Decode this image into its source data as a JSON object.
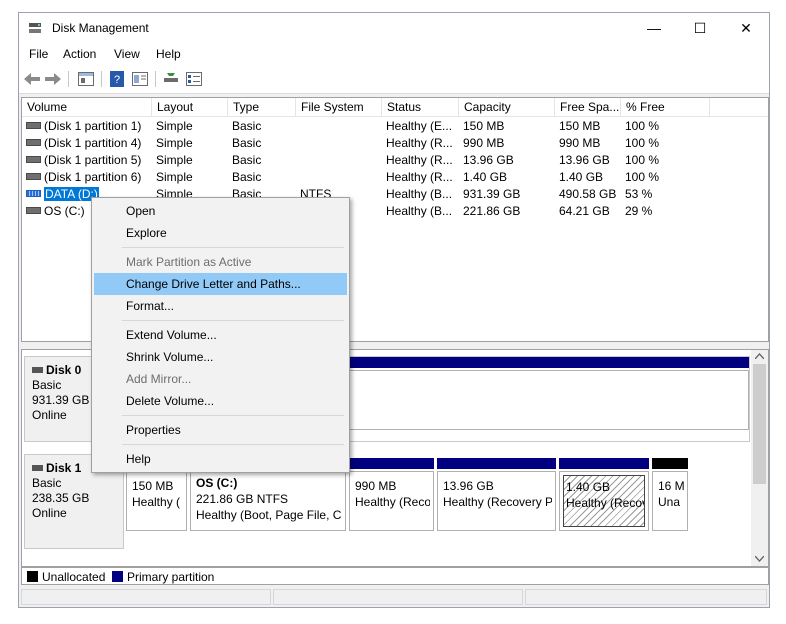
{
  "window": {
    "title": "Disk Management",
    "minimize_glyph": "—",
    "maximize_glyph": "☐",
    "close_glyph": "✕"
  },
  "menu": [
    "File",
    "Action",
    "View",
    "Help"
  ],
  "toolbar": [
    "back-icon",
    "forward-icon",
    "properties-icon",
    "help-icon",
    "console-icon",
    "refresh-icon",
    "list-icon"
  ],
  "columns": [
    "Volume",
    "Layout",
    "Type",
    "File System",
    "Status",
    "Capacity",
    "Free Spa...",
    "% Free"
  ],
  "volumes": [
    {
      "volume": "(Disk 1 partition 1)",
      "layout": "Simple",
      "type": "Basic",
      "fs": "",
      "status": "Healthy (E...",
      "capacity": "150 MB",
      "free": "150 MB",
      "pct": "100 %"
    },
    {
      "volume": "(Disk 1 partition 4)",
      "layout": "Simple",
      "type": "Basic",
      "fs": "",
      "status": "Healthy (R...",
      "capacity": "990 MB",
      "free": "990 MB",
      "pct": "100 %"
    },
    {
      "volume": "(Disk 1 partition 5)",
      "layout": "Simple",
      "type": "Basic",
      "fs": "",
      "status": "Healthy (R...",
      "capacity": "13.96 GB",
      "free": "13.96 GB",
      "pct": "100 %"
    },
    {
      "volume": "(Disk 1 partition 6)",
      "layout": "Simple",
      "type": "Basic",
      "fs": "",
      "status": "Healthy (R...",
      "capacity": "1.40 GB",
      "free": "1.40 GB",
      "pct": "100 %"
    },
    {
      "volume": "DATA (D:)",
      "layout": "Simple",
      "type": "Basic",
      "fs": "NTFS",
      "status": "Healthy (B...",
      "capacity": "931.39 GB",
      "free": "490.58 GB",
      "pct": "53 %"
    },
    {
      "volume": "OS (C:)",
      "layout": "",
      "type": "",
      "fs": "",
      "status": "Healthy (B...",
      "capacity": "221.86 GB",
      "free": "64.21 GB",
      "pct": "29 %"
    }
  ],
  "disks": [
    {
      "name": "Disk 0",
      "kind": "Basic",
      "size": "931.39 GB",
      "state": "Online"
    },
    {
      "name": "Disk 1",
      "kind": "Basic",
      "size": "238.35 GB",
      "state": "Online"
    }
  ],
  "disk1_partitions": [
    {
      "title": "",
      "line1": "150 MB",
      "line2": "Healthy ("
    },
    {
      "title": "OS  (C:)",
      "line1": "221.86 GB NTFS",
      "line2": "Healthy (Boot, Page File, Cr"
    },
    {
      "title": "",
      "line1": "990 MB",
      "line2": "Healthy (Reco"
    },
    {
      "title": "",
      "line1": "13.96 GB",
      "line2": "Healthy (Recovery P"
    },
    {
      "title": "",
      "line1": "1.40 GB",
      "line2": "Healthy (Recov"
    },
    {
      "title": "",
      "line1": "16 M",
      "line2": "Una"
    }
  ],
  "legend": {
    "unallocated": "Unallocated",
    "primary": "Primary partition"
  },
  "colors": {
    "primary": "#000080",
    "unallocated": "#000000",
    "selection": "#0078d7",
    "menu_highlight": "#91c9f7"
  },
  "context_menu": [
    {
      "label": "Open",
      "enabled": true
    },
    {
      "label": "Explore",
      "enabled": true
    },
    {
      "label": "Mark Partition as Active",
      "enabled": false
    },
    {
      "label": "Change Drive Letter and Paths...",
      "enabled": true,
      "highlighted": true
    },
    {
      "label": "Format...",
      "enabled": true
    },
    {
      "label": "Extend Volume...",
      "enabled": true
    },
    {
      "label": "Shrink Volume...",
      "enabled": true
    },
    {
      "label": "Add Mirror...",
      "enabled": false
    },
    {
      "label": "Delete Volume...",
      "enabled": true
    },
    {
      "label": "Properties",
      "enabled": true
    },
    {
      "label": "Help",
      "enabled": true
    }
  ]
}
